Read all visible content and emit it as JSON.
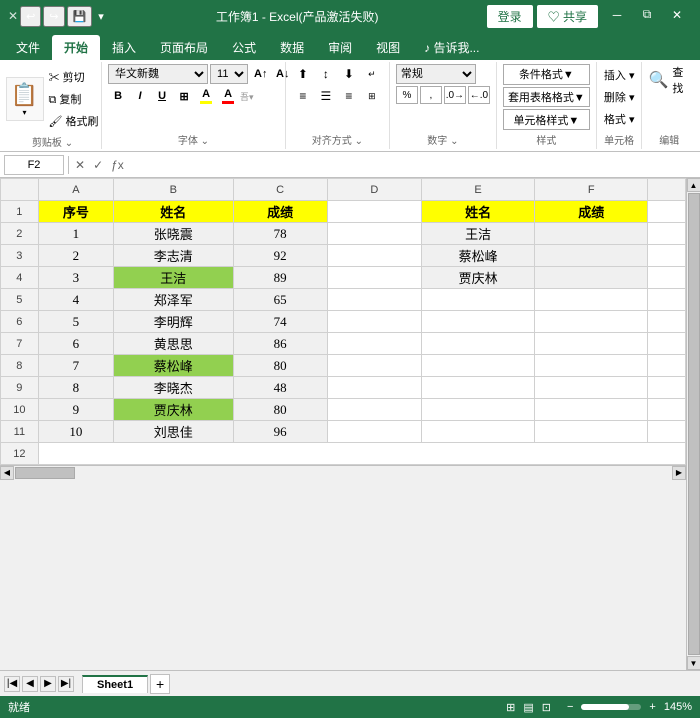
{
  "titleBar": {
    "title": "工作簿1 - Excel(产品激活失败)",
    "quickAccess": [
      "↩",
      "↪",
      "💾"
    ]
  },
  "ribbonTabs": [
    "文件",
    "开始",
    "插入",
    "页面布局",
    "公式",
    "数据",
    "审阅",
    "视图",
    "♪ 告诉我..."
  ],
  "activeTab": "开始",
  "ribbon": {
    "groups": [
      {
        "name": "剪贴板"
      },
      {
        "name": "字体"
      },
      {
        "name": "对齐方式"
      },
      {
        "name": "数字"
      },
      {
        "name": "样式"
      },
      {
        "name": "单元格"
      },
      {
        "name": "编辑"
      }
    ],
    "font": {
      "name": "华文新魏",
      "size": "11"
    },
    "conditionalFormat": "条件格式▼",
    "tableFormat": "套用表格格式▼",
    "cellStyle": "单元格样式▼",
    "insert": "单元格",
    "edit": "编辑"
  },
  "formulaBar": {
    "cellRef": "F2",
    "formula": ""
  },
  "sheet": {
    "colHeaders": [
      "",
      "A",
      "B",
      "C",
      "D",
      "E",
      "F"
    ],
    "rows": [
      {
        "row": 1,
        "a": "序号",
        "b": "姓名",
        "c": "成绩",
        "d": "",
        "e": "姓名",
        "f": "成绩",
        "aStyle": "header",
        "bStyle": "header",
        "cStyle": "header",
        "eStyle": "header",
        "fStyle": "header"
      },
      {
        "row": 2,
        "a": "1",
        "b": "张晓震",
        "c": "78",
        "d": "",
        "e": "王洁",
        "f": ""
      },
      {
        "row": 3,
        "a": "2",
        "b": "李志清",
        "c": "92",
        "d": "",
        "e": "蔡松峰",
        "f": ""
      },
      {
        "row": 4,
        "a": "3",
        "b": "王洁",
        "c": "89",
        "d": "",
        "e": "贾庆林",
        "f": "",
        "bStyle": "green"
      },
      {
        "row": 5,
        "a": "4",
        "b": "郑泽军",
        "c": "65",
        "d": "",
        "e": "",
        "f": ""
      },
      {
        "row": 6,
        "a": "5",
        "b": "李明辉",
        "c": "74",
        "d": "",
        "e": "",
        "f": ""
      },
      {
        "row": 7,
        "a": "6",
        "b": "黄思思",
        "c": "86",
        "d": "",
        "e": "",
        "f": ""
      },
      {
        "row": 8,
        "a": "7",
        "b": "蔡松峰",
        "c": "80",
        "d": "",
        "e": "",
        "f": "",
        "bStyle": "green"
      },
      {
        "row": 9,
        "a": "8",
        "b": "李晓杰",
        "c": "48",
        "d": "",
        "e": "",
        "f": ""
      },
      {
        "row": 10,
        "a": "9",
        "b": "贾庆林",
        "c": "80",
        "d": "",
        "e": "",
        "f": "",
        "bStyle": "green"
      },
      {
        "row": 11,
        "a": "10",
        "b": "刘思佳",
        "c": "96",
        "d": "",
        "e": "",
        "f": ""
      }
    ]
  },
  "sheetTabs": [
    "Sheet1"
  ],
  "statusBar": {
    "status": "就绪",
    "zoom": "145%"
  }
}
